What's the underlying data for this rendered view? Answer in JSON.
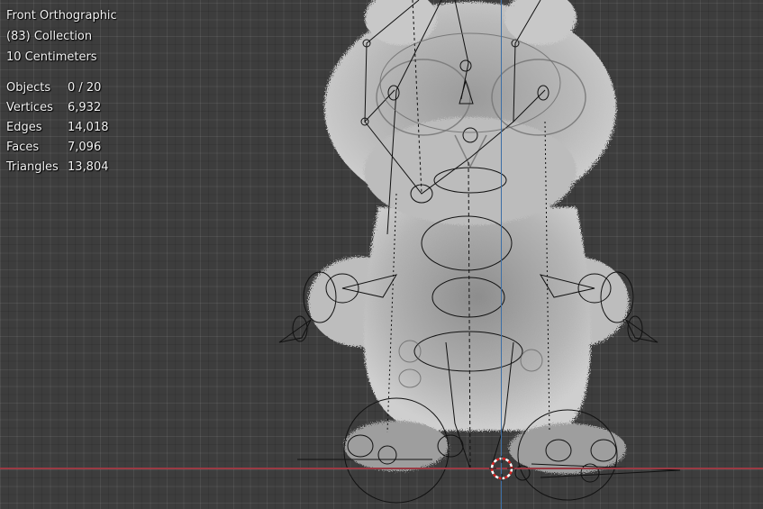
{
  "viewport": {
    "view_name": "Front Orthographic",
    "collection": "(83) Collection",
    "scale": "10 Centimeters",
    "background_color": "#3d3d3d",
    "x_axis_color": "#9b3a44",
    "z_axis_color": "#3d6fa6"
  },
  "stats": [
    {
      "label": "Objects",
      "value": "0 / 20"
    },
    {
      "label": "Vertices",
      "value": "6,932"
    },
    {
      "label": "Edges",
      "value": "14,018"
    },
    {
      "label": "Faces",
      "value": "7,096"
    },
    {
      "label": "Triangles",
      "value": "13,804"
    }
  ],
  "scene": {
    "object": "fluffy owl mesh with armature rig",
    "fur_color": "#c7c7c7",
    "rig_line_color": "#111111",
    "cursor_icon": "3d-cursor-icon"
  }
}
